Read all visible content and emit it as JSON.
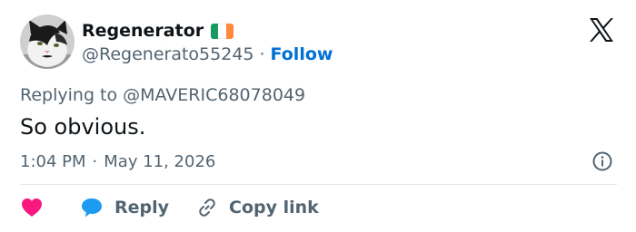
{
  "author": {
    "display_name": "Regenerator",
    "handle": "@Regenerato55245",
    "follow_label": "Follow",
    "flag_icon": "ireland-flag-icon",
    "flag_colors": [
      "#169b62",
      "#ffffff",
      "#ff883e"
    ],
    "avatar_icon": "cat-avatar"
  },
  "separator": "·",
  "reply_context": {
    "prefix": "Replying to",
    "target": "@MAVERIC68078049"
  },
  "tweet": {
    "text": "So obvious.",
    "time": "1:04 PM",
    "date": "May 11, 2026"
  },
  "actions": {
    "like_icon": "heart-icon",
    "reply_icon": "speech-bubble-icon",
    "reply_label": "Reply",
    "copy_icon": "link-icon",
    "copy_label": "Copy link"
  },
  "colors": {
    "text": "#0f1419",
    "secondary": "#536471",
    "follow": "#006fd6",
    "like": "#f91880",
    "reply": "#1d9bf0",
    "divider": "#e1e8ed"
  }
}
